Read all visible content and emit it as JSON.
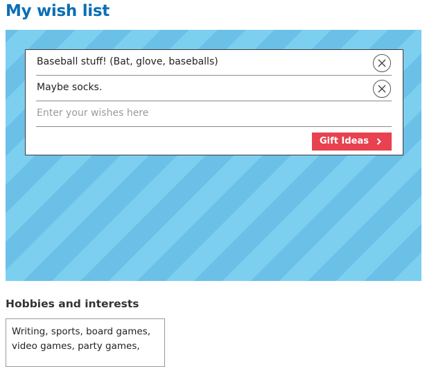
{
  "page": {
    "title": "My wish list"
  },
  "wishes": {
    "items": [
      {
        "text": "Baseball stuff! (Bat, glove, baseballs)"
      },
      {
        "text": "Maybe socks."
      }
    ],
    "input_placeholder": "Enter your wishes here",
    "gift_ideas_label": "Gift Ideas"
  },
  "hobbies": {
    "heading": "Hobbies and interests",
    "value": "Writing, sports, board games, video games, party games,"
  },
  "colors": {
    "title": "#0a6fb5",
    "stripe_light": "#7dcff0",
    "stripe_dark": "#6bc0e8",
    "gift_button": "#e8414f"
  },
  "icons": {
    "remove": "close-circle-icon",
    "gift_chevron": "chevron-right-icon"
  }
}
